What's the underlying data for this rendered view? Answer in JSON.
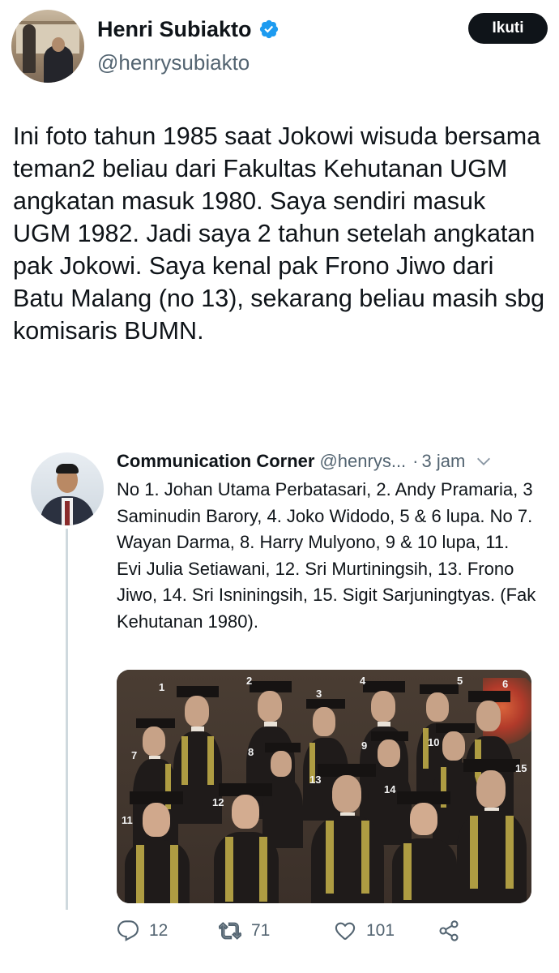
{
  "author": {
    "display_name": "Henri Subiakto",
    "handle": "@henrysubiakto",
    "verified": true
  },
  "follow_button": "Ikuti",
  "tweet_text": "Ini foto tahun 1985 saat Jokowi wisuda bersama teman2 beliau dari Fakultas Kehutanan UGM angkatan masuk 1980. Saya sendiri masuk UGM 1982. Jadi saya 2 tahun setelah angkatan pak Jokowi. Saya kenal pak Frono Jiwo dari Batu Malang (no 13), sekarang beliau masih sbg komisaris BUMN.",
  "quoted": {
    "name": "Communication Corner",
    "handle": "@henrys...",
    "separator": "·",
    "time": "3 jam",
    "text": "No 1. Johan Utama Perbatasari, 2. Andy Pramaria, 3 Saminudin Barory, 4. Joko Widodo, 5 & 6 lupa. No 7. Wayan Darma, 8. Harry Mulyono, 9 & 10 lupa, 11. Evi Julia Setiawani, 12. Sri Murtiningsih, 13. Frono Jiwo, 14. Sri Isniningsih, 15. Sigit Sarjuningtyas. (Fak Kehutanan 1980).",
    "photo_numbers": [
      "1",
      "2",
      "3",
      "4",
      "5",
      "6",
      "7",
      "8",
      "9",
      "10",
      "11",
      "12",
      "13",
      "14",
      "15"
    ],
    "actions": {
      "replies": "12",
      "retweets": "71",
      "likes": "101"
    }
  },
  "colors": {
    "text": "#0f1419",
    "secondary": "#536471",
    "verified": "#1d9bf0",
    "follow_bg": "#0f1419",
    "thread_line": "#cfd9de"
  },
  "icons": [
    "verified-badge-icon",
    "chevron-down-icon",
    "reply-icon",
    "retweet-icon",
    "like-icon",
    "share-icon"
  ]
}
